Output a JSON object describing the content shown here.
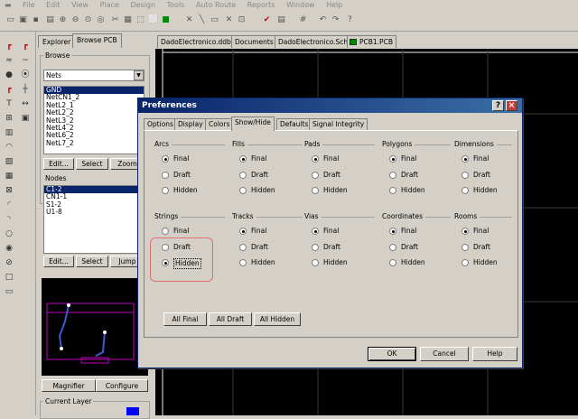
{
  "menu": [
    "File",
    "Edit",
    "View",
    "Place",
    "Design",
    "Tools",
    "Auto Route",
    "Reports",
    "Window",
    "Help"
  ],
  "left_panel": {
    "tabs": [
      "Explorer",
      "Browse PCB"
    ],
    "browse_label": "Browse",
    "browse_select": "Nets",
    "nets": [
      "GND",
      "NetCN1_2",
      "NetL2_1",
      "NetL2_2",
      "NetL3_2",
      "NetL4_2",
      "NetL6_2",
      "NetL7_2"
    ],
    "nets_buttons": [
      "Edit...",
      "Select",
      "Zoom"
    ],
    "nodes_label": "Nodes",
    "nodes": [
      "C1-2",
      "CN1-1",
      "S1-2",
      "U1-8"
    ],
    "nodes_buttons": [
      "Edit...",
      "Select",
      "Jump"
    ],
    "magnifier_label": "Magnifier",
    "configure_label": "Configure",
    "current_layer_label": "Current Layer"
  },
  "doc_tabs": [
    "DadoElectronico.ddb",
    "Documents",
    "DadoElectronico.Sch",
    "PCB1.PCB"
  ],
  "dialog": {
    "title": "Preferences",
    "help_btn": "?",
    "close_btn": "×",
    "tabs": [
      "Options",
      "Display",
      "Colors",
      "Show/Hide",
      "Defaults",
      "Signal Integrity"
    ],
    "active_tab": "Show/Hide",
    "sections_row1": [
      {
        "title": "Arcs",
        "options": [
          "Final",
          "Draft",
          "Hidden"
        ],
        "selected": "Final"
      },
      {
        "title": "Fills",
        "options": [
          "Final",
          "Draft",
          "Hidden"
        ],
        "selected": "Final"
      },
      {
        "title": "Pads",
        "options": [
          "Final",
          "Draft",
          "Hidden"
        ],
        "selected": "Final"
      },
      {
        "title": "Polygons",
        "options": [
          "Final",
          "Draft",
          "Hidden"
        ],
        "selected": "Final"
      },
      {
        "title": "Dimensions",
        "options": [
          "Final",
          "Draft",
          "Hidden"
        ],
        "selected": "Final"
      }
    ],
    "sections_row2": [
      {
        "title": "Strings",
        "options": [
          "Final",
          "Draft",
          "Hidden"
        ],
        "selected": "Hidden"
      },
      {
        "title": "Tracks",
        "options": [
          "Final",
          "Draft",
          "Hidden"
        ],
        "selected": "Final"
      },
      {
        "title": "Vias",
        "options": [
          "Final",
          "Draft",
          "Hidden"
        ],
        "selected": "Final"
      },
      {
        "title": "Coordinates",
        "options": [
          "Final",
          "Draft",
          "Hidden"
        ],
        "selected": "Final"
      },
      {
        "title": "Rooms",
        "options": [
          "Final",
          "Draft",
          "Hidden"
        ],
        "selected": "Final"
      }
    ],
    "all_buttons": [
      "All Final",
      "All Draft",
      "All Hidden"
    ],
    "footer_buttons": [
      "OK",
      "Cancel",
      "Help"
    ]
  },
  "colors": {
    "title_bar": "#0a246a",
    "highlight_box": "#e07070",
    "track": "#3a5cd0",
    "outline": "#c000c0"
  }
}
